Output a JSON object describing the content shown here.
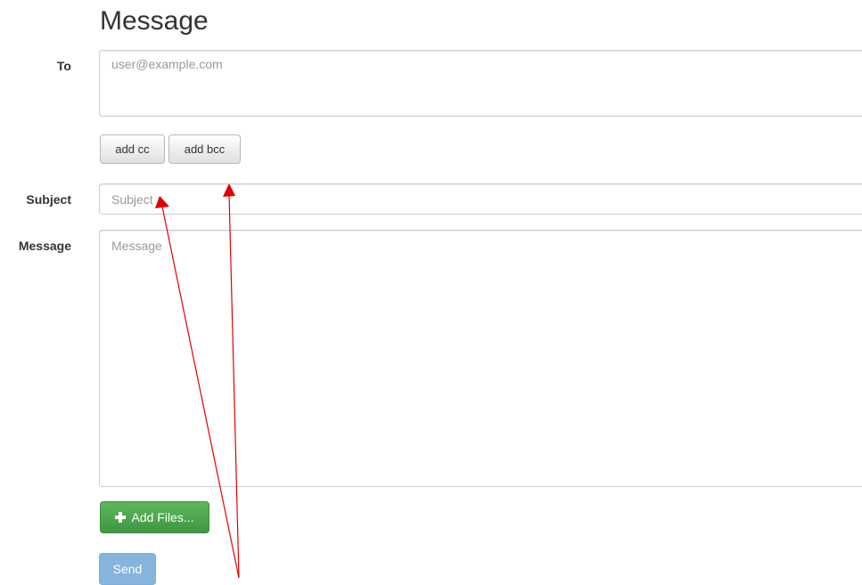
{
  "page": {
    "title": "Message"
  },
  "form": {
    "to": {
      "label": "To",
      "placeholder": "user@example.com",
      "value": ""
    },
    "cc_button": "add cc",
    "bcc_button": "add bcc",
    "subject": {
      "label": "Subject",
      "placeholder": "Subject",
      "value": ""
    },
    "message": {
      "label": "Message",
      "placeholder": "Message",
      "value": ""
    },
    "add_files_button": "Add Files...",
    "send_button": "Send"
  },
  "icons": {
    "add_files": "plus-icon"
  },
  "colors": {
    "success": "#5cb85c",
    "primary_disabled": "#7fb0dc",
    "annotation_arrow": "#e00000"
  }
}
